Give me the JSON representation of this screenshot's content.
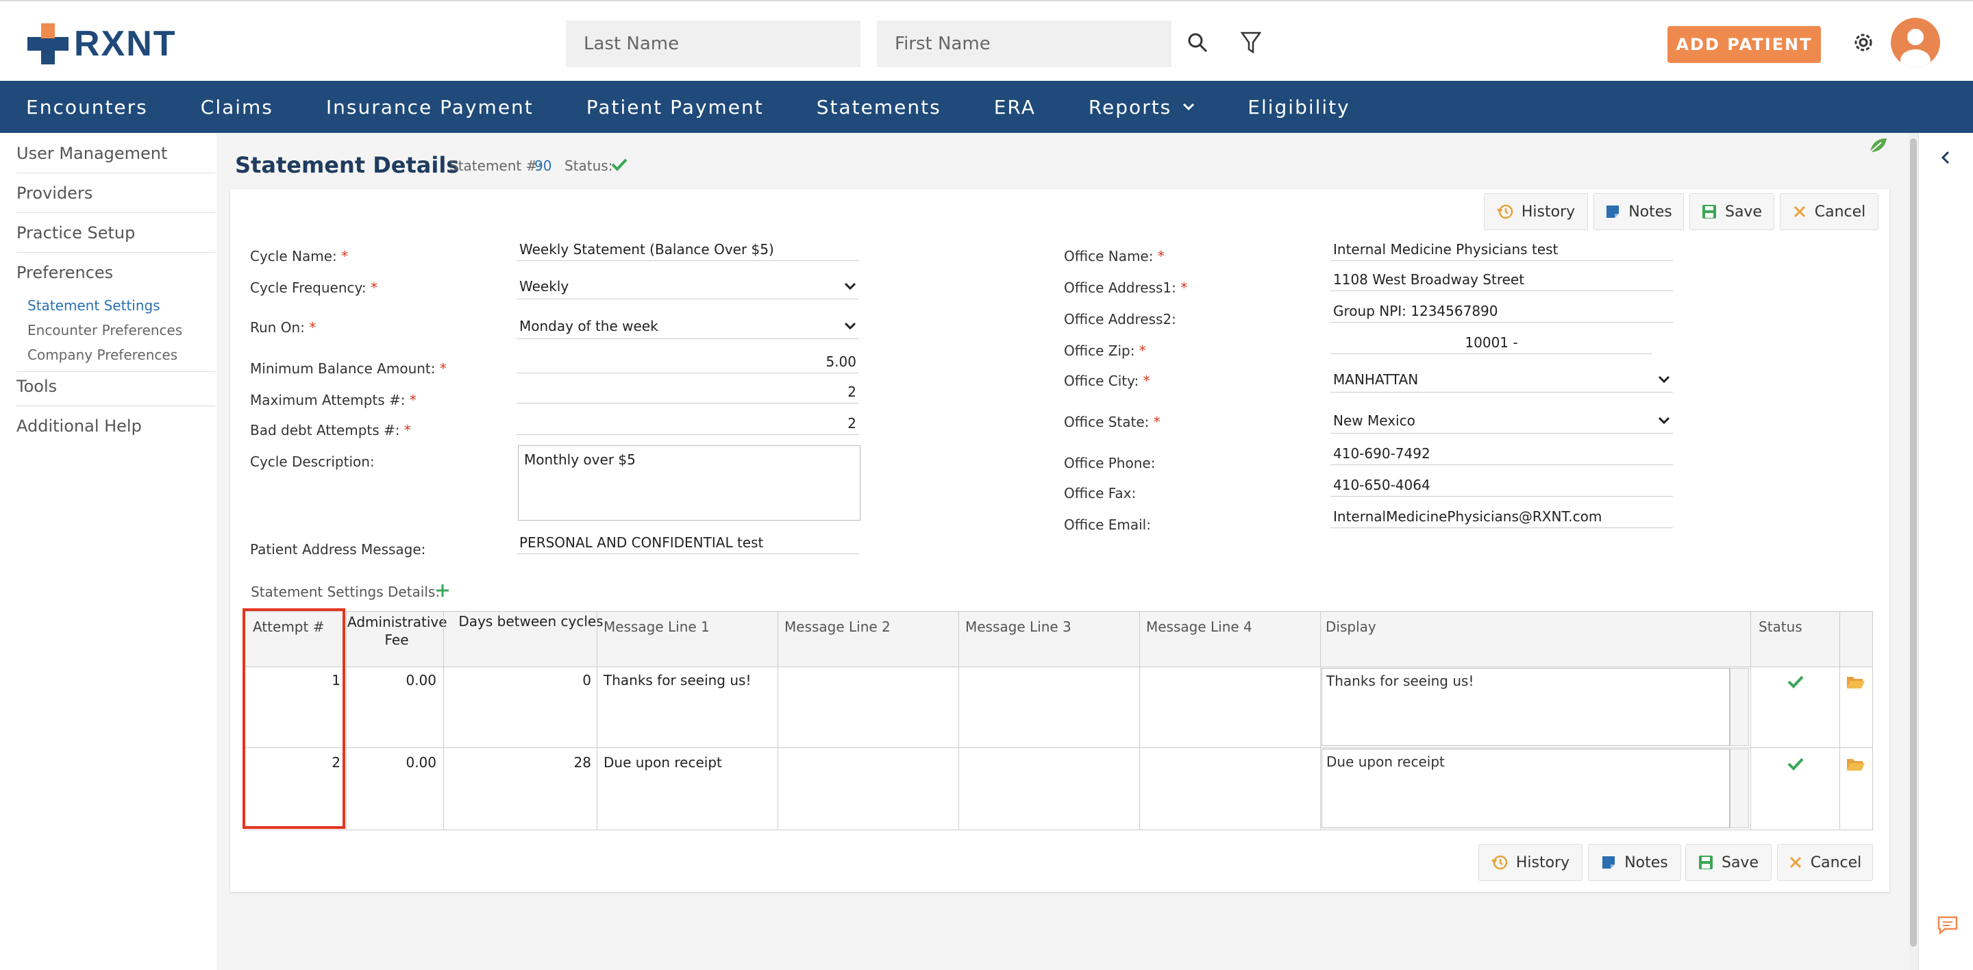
{
  "header": {
    "logo_text": "RXNT",
    "last_name_placeholder": "Last Name",
    "first_name_placeholder": "First Name",
    "add_patient_label": "ADD PATIENT",
    "icons": [
      "search-icon",
      "filter-icon",
      "gear-icon",
      "avatar"
    ]
  },
  "nav": {
    "items": [
      "Encounters",
      "Claims",
      "Insurance Payment",
      "Patient Payment",
      "Statements",
      "ERA",
      "Reports",
      "Eligibility"
    ]
  },
  "sidebar": {
    "items": [
      "User Management",
      "Providers",
      "Practice Setup",
      "Preferences"
    ],
    "sub_items": [
      "Statement Settings",
      "Encounter Preferences",
      "Company Preferences"
    ],
    "items2": [
      "Tools",
      "Additional Help"
    ]
  },
  "page": {
    "title": "Statement Details",
    "statement_label": "Statement #:",
    "statement_number": "90",
    "status_label": "Status:"
  },
  "buttons": {
    "history": "History",
    "notes": "Notes",
    "save": "Save",
    "cancel": "Cancel"
  },
  "form_left": {
    "cycle_name_label": "Cycle Name:",
    "cycle_name": "Weekly Statement (Balance Over $5)",
    "cycle_frequency_label": "Cycle Frequency:",
    "cycle_frequency": "Weekly",
    "run_on_label": "Run On:",
    "run_on": "Monday of the week",
    "min_balance_label": "Minimum Balance Amount:",
    "min_balance": "5.00",
    "max_attempts_label": "Maximum Attempts #:",
    "max_attempts": "2",
    "bad_debt_label": "Bad debt Attempts #:",
    "bad_debt": "2",
    "cycle_desc_label": "Cycle Description:",
    "cycle_desc": "Monthly over $5",
    "patient_address_label": "Patient Address Message:",
    "patient_address": "PERSONAL AND CONFIDENTIAL test"
  },
  "form_right": {
    "office_name_label": "Office Name:",
    "office_name": "Internal Medicine Physicians test",
    "office_address1_label": "Office Address1:",
    "office_address1": "1108 West Broadway Street",
    "office_address2_label": "Office Address2:",
    "office_address2": "Group NPI: 1234567890",
    "office_zip_label": "Office Zip:",
    "office_zip": "10001 -",
    "office_city_label": "Office City:",
    "office_city": "MANHATTAN",
    "office_state_label": "Office State:",
    "office_state": "New Mexico",
    "office_phone_label": "Office Phone:",
    "office_phone": "410-690-7492",
    "office_fax_label": "Office Fax:",
    "office_fax": "410-650-4064",
    "office_email_label": "Office Email:",
    "office_email": "InternalMedicinePhysicians@RXNT.com"
  },
  "grid": {
    "section_label": "Statement Settings Details:",
    "headers": [
      "Attempt #",
      "Administrative Fee",
      "Days between cycles",
      "Message Line 1",
      "Message Line 2",
      "Message Line 3",
      "Message Line 4",
      "Display",
      "Status"
    ],
    "rows": [
      {
        "attempt": "1",
        "fee": "0.00",
        "days": "0",
        "msg1": "Thanks for seeing us!",
        "msg2": "",
        "msg3": "",
        "msg4": "",
        "display": "Thanks for seeing us!"
      },
      {
        "attempt": "2",
        "fee": "0.00",
        "days": "28",
        "msg1": "Due upon receipt",
        "msg2": "",
        "msg3": "",
        "msg4": "",
        "display": "Due upon receipt"
      }
    ]
  },
  "colors": {
    "nav": "#1f4a79",
    "accent": "#ef8a4e",
    "status_ok": "#3aa655",
    "highlight": "#e2361f"
  }
}
